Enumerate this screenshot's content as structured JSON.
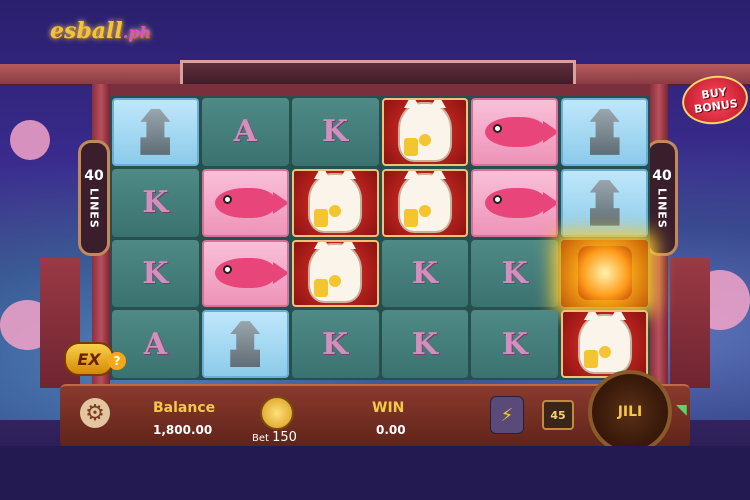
{
  "brand": {
    "name": "esball",
    "suffix": ".ph"
  },
  "header": {
    "buy_bonus": "BUY BONUS"
  },
  "lines": {
    "count": "40",
    "label": "LINES"
  },
  "grid": {
    "columns": [
      [
        "lantern",
        "K",
        "K",
        "A"
      ],
      [
        "A",
        "fish",
        "fish",
        "lantern"
      ],
      [
        "K",
        "cat",
        "cat",
        "K"
      ],
      [
        "cat",
        "cat",
        "K",
        "K"
      ],
      [
        "fish",
        "fish",
        "K",
        "K"
      ],
      [
        "lantern",
        "lantern",
        "orb",
        "cat"
      ]
    ]
  },
  "ex_button": {
    "label": "EX",
    "help": "?"
  },
  "balance": {
    "label": "Balance",
    "value": "1,800.00"
  },
  "bet": {
    "prefix": "Bet",
    "value": "150"
  },
  "win": {
    "label": "WIN",
    "value": "0.00"
  },
  "bet_level": "45",
  "spin_button": {
    "label": "JILI"
  },
  "colors": {
    "accent": "#f3c94a",
    "frame": "#8a3a2d",
    "reel_bg": "#3a7270"
  }
}
